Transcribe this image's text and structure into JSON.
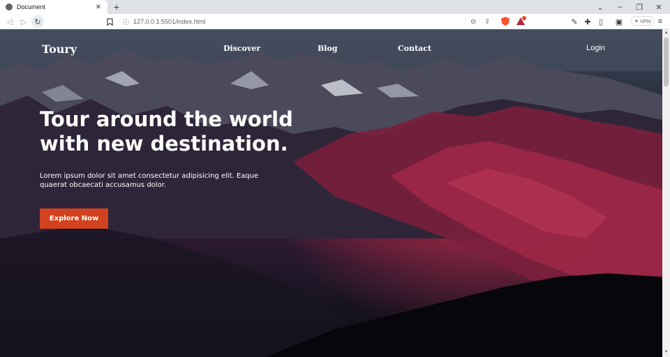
{
  "browser": {
    "tab_title": "Document",
    "tab_close": "✕",
    "new_tab": "+",
    "url": "127.0.0.1:5501/index.html",
    "vpn_label": "VPN",
    "window_controls": {
      "dropdown": "⌄",
      "minimize": "–",
      "restore": "❐",
      "close": "✕"
    }
  },
  "page": {
    "logo": "Toury",
    "nav": [
      "Discover",
      "Blog",
      "Contact"
    ],
    "login": "Login",
    "hero_title": "Tour around the world with new destination.",
    "hero_text": "Lorem ipsum dolor sit amet consectetur adipisicing elit. Eaque quaerat obcaecati accusamus dolor.",
    "cta": "Explore Now"
  },
  "colors": {
    "accent": "#d2421e",
    "nav_text": "#ffffff"
  }
}
